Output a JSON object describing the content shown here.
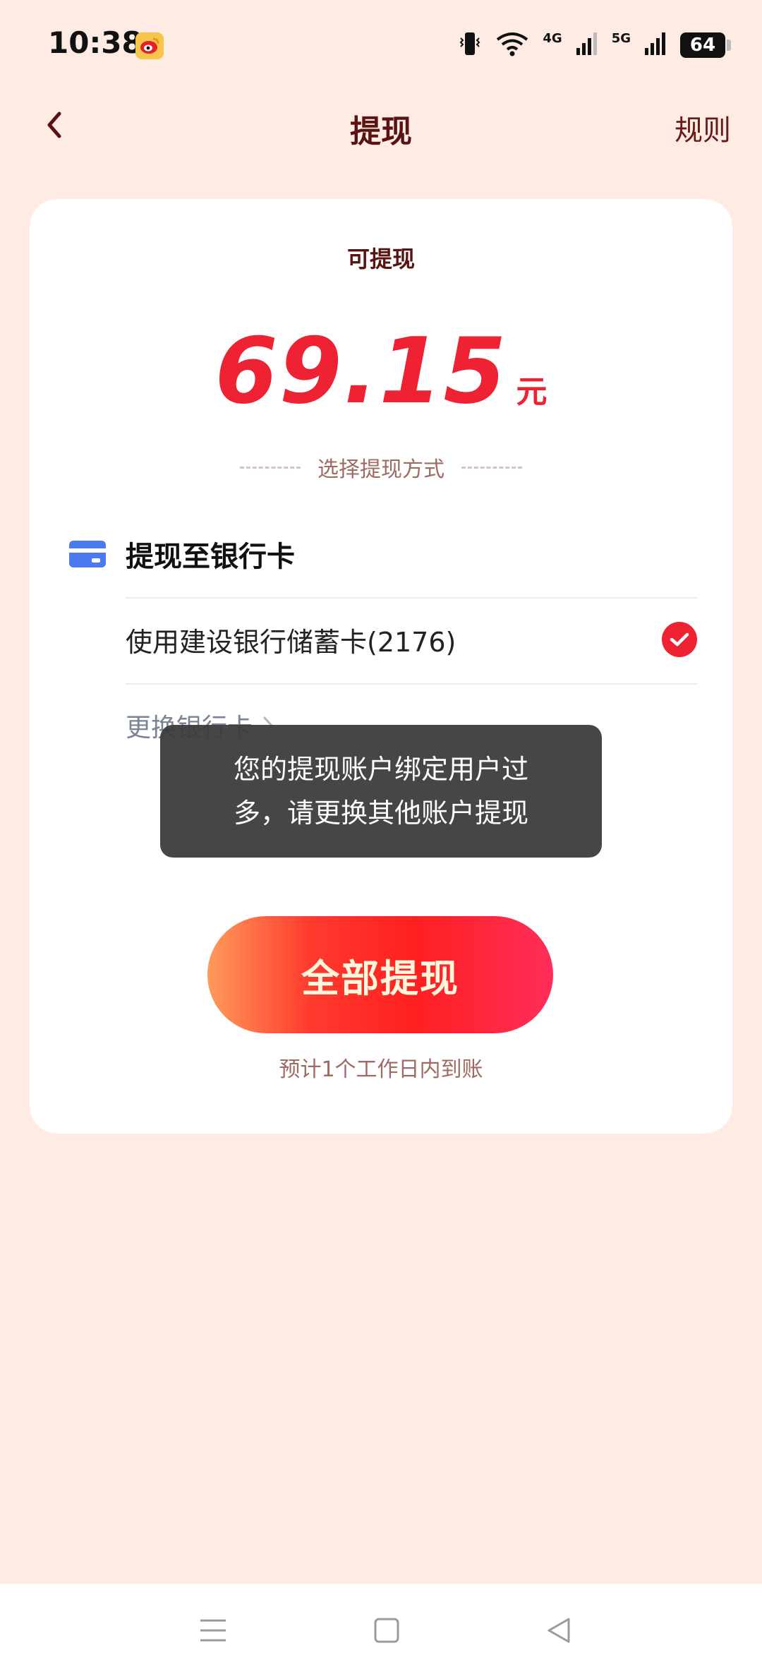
{
  "status_bar": {
    "time": "10:38",
    "net1": "4G",
    "net2": "5G",
    "battery": "64"
  },
  "header": {
    "title": "提现",
    "rules": "规则"
  },
  "card": {
    "available_label": "可提现",
    "amount": "69.15",
    "unit": "元",
    "method_label": "选择提现方式",
    "bank_header": "提现至银行卡",
    "bank_option": "使用建设银行储蓄卡(2176)",
    "change_card": "更换银行卡",
    "withdraw_button": "全部提现",
    "eta": "预计1个工作日内到账"
  },
  "toast": {
    "message": "您的提现账户绑定用户过多，请更换其他账户提现"
  },
  "colors": {
    "background": "#fdebe4",
    "accent": "#ee2233",
    "title": "#5a1310"
  }
}
